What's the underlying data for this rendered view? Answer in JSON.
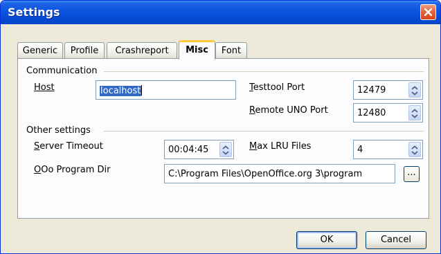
{
  "window": {
    "title": "Settings"
  },
  "tabs": [
    {
      "label": "Generic",
      "active": false
    },
    {
      "label": "Profile",
      "active": false
    },
    {
      "label": "Crashreport",
      "active": false
    },
    {
      "label": "Misc",
      "active": true
    },
    {
      "label": "Font",
      "active": false
    }
  ],
  "communication": {
    "group_label": "Communication",
    "host": {
      "label": "Host",
      "value": "localhost"
    },
    "testtool_port": {
      "label_first": "T",
      "label_rest": "esttool Port",
      "value": "12479"
    },
    "remote_uno_port": {
      "label_first": "R",
      "label_rest": "emote UNO Port",
      "value": "12480"
    }
  },
  "other_settings": {
    "group_label": "Other settings",
    "server_timeout": {
      "label_first": "S",
      "label_rest": "erver Timeout",
      "value": "00:04:45"
    },
    "max_lru_files": {
      "label_first": "M",
      "label_rest": "ax LRU Files",
      "value": "4"
    },
    "program_dir": {
      "label_first": "O",
      "label_rest": "Oo Program Dir",
      "value": "C:\\Program Files\\OpenOffice.org 3\\program",
      "browse_label": "..."
    }
  },
  "buttons": {
    "ok": "OK",
    "cancel": "Cancel"
  },
  "colors": {
    "title_bar": "#0a55e0",
    "close_button": "#e4623c",
    "active_tab_accent": "#ffc73c",
    "selection": "#316ac5"
  }
}
